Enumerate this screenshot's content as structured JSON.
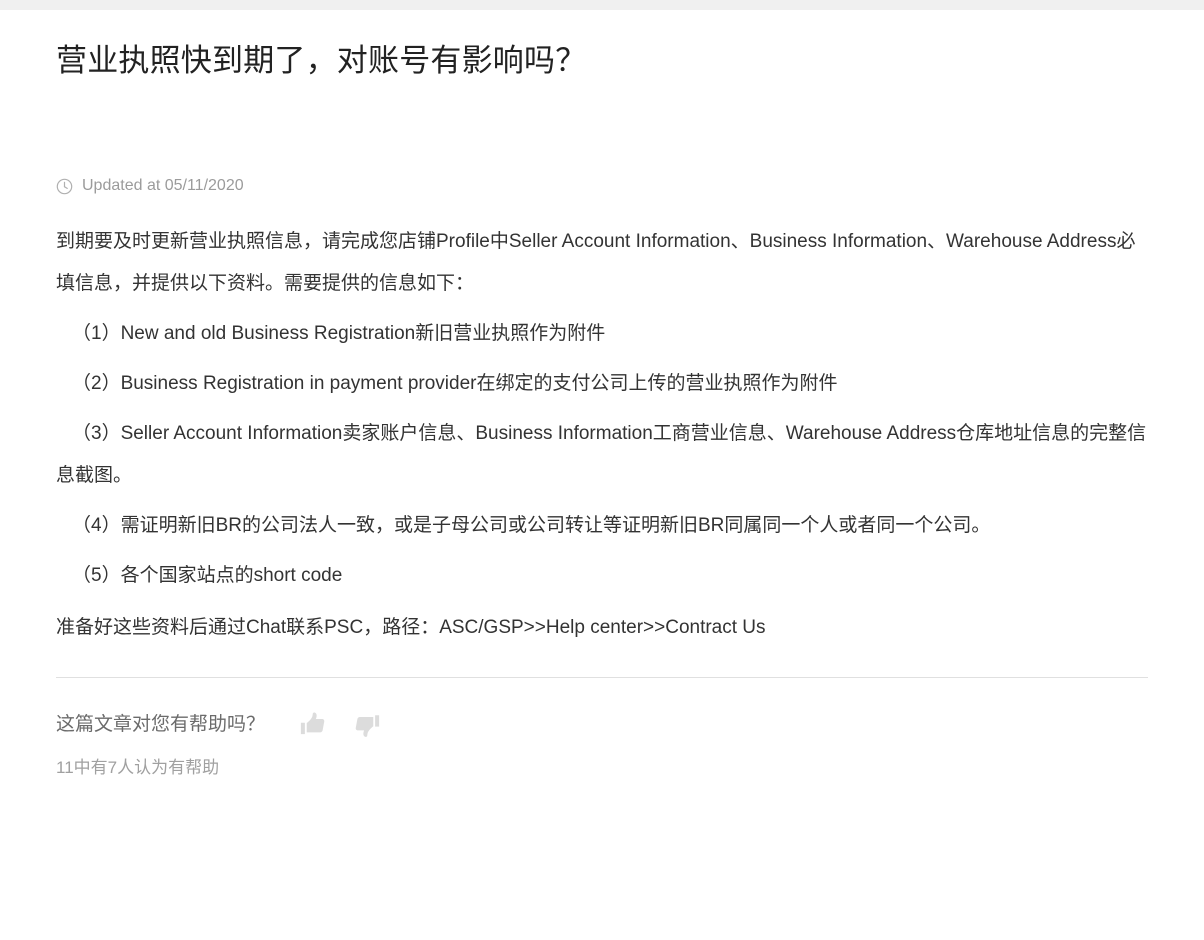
{
  "article": {
    "title": "营业执照快到期了，对账号有影响吗？",
    "meta": {
      "icon": "clock-icon",
      "updated_text": "Updated at 05/11/2020"
    },
    "intro": "到期要及时更新营业执照信息，请完成您店铺Profile中Seller Account Information、Business Information、Warehouse Address必填信息，并提供以下资料。需要提供的信息如下：",
    "items": [
      "（1）New and old Business Registration新旧营业执照作为附件",
      "（2）Business Registration in payment provider在绑定的支付公司上传的营业执照作为附件",
      "（3）Seller Account Information卖家账户信息、Business Information工商营业信息、Warehouse Address仓库地址信息的完整信息截图。",
      "（4）需证明新旧BR的公司法人一致，或是子母公司或公司转让等证明新旧BR同属同一个人或者同一个公司。",
      "（5）各个国家站点的short code"
    ],
    "closing": "准备好这些资料后通过Chat联系PSC，路径：ASC/GSP>>Help center>>Contract Us"
  },
  "feedback": {
    "question": "这篇文章对您有帮助吗？",
    "thumbs_up_icon": "thumbs-up-icon",
    "thumbs_down_icon": "thumbs-down-icon",
    "count_text": "11中有7人认为有帮助"
  },
  "colors": {
    "top_strip": "#f0f0f0",
    "title_text": "#222222",
    "body_text": "#333333",
    "meta_text": "#9b9b9b",
    "divider": "#e0e0e0",
    "thumb_icon": "#dcdcdc",
    "feedback_question": "#6b6b6b",
    "feedback_count": "#a0a0a0"
  }
}
